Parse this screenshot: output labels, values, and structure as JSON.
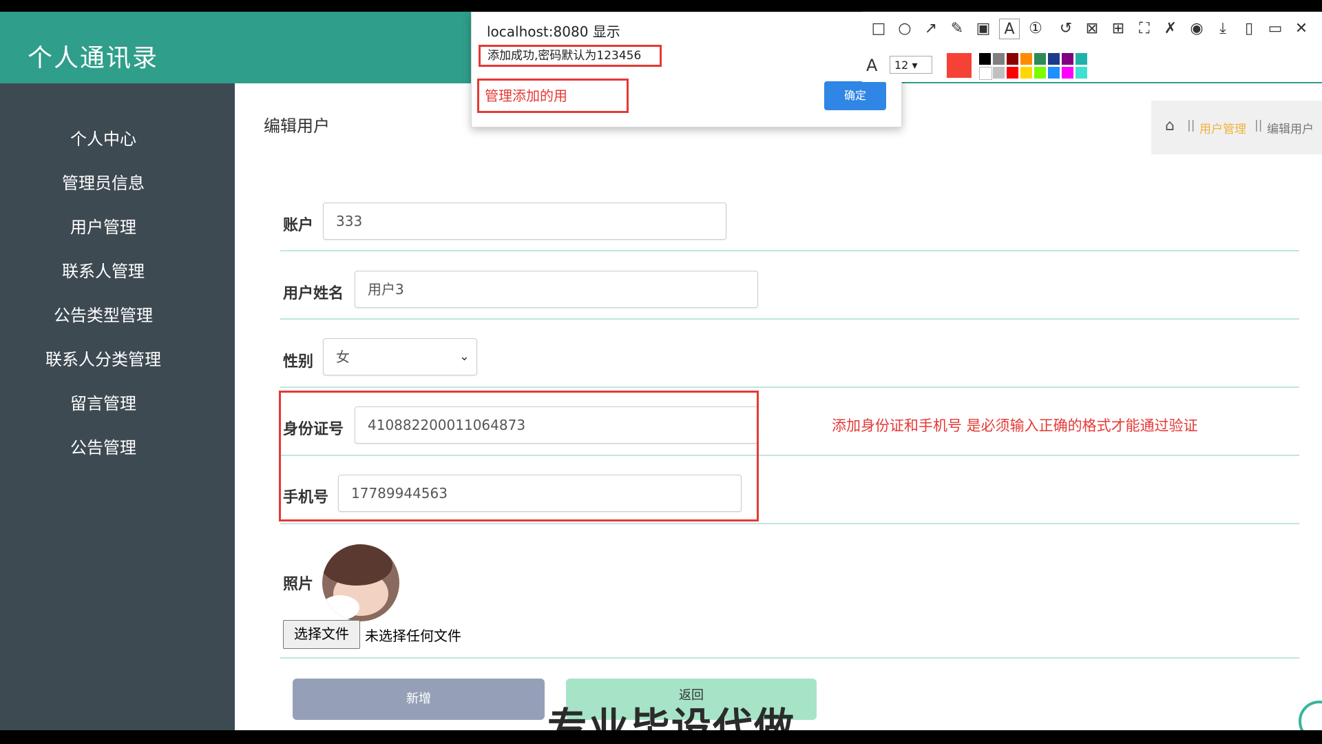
{
  "header": {
    "title": "个人通讯录"
  },
  "sidebar": {
    "items": [
      "个人中心",
      "管理员信息",
      "用户管理",
      "联系人管理",
      "公告类型管理",
      "联系人分类管理",
      "留言管理",
      "公告管理"
    ]
  },
  "page": {
    "title": "编辑用户"
  },
  "breadcrumb": {
    "sep": "||",
    "section": "用户管理",
    "current": "编辑用户"
  },
  "form": {
    "account": {
      "label": "账户",
      "value": "333"
    },
    "name": {
      "label": "用户姓名",
      "value": "用户3"
    },
    "gender": {
      "label": "性别",
      "value": "女"
    },
    "id_card": {
      "label": "身份证号",
      "value": "410882200011064873"
    },
    "phone": {
      "label": "手机号",
      "value": "17789944563"
    },
    "photo": {
      "label": "照片",
      "file_button": "选择文件",
      "file_status": "未选择任何文件"
    },
    "annotation_note": "添加身份证和手机号 是必须输入正确的格式才能通过验证",
    "submit_label": "新增",
    "back_label": "返回"
  },
  "watermark": "专业毕设代做",
  "dialog": {
    "title": "localhost:8080 显示",
    "message": "添加成功,密码默认为123456",
    "annotation": "管理添加的用",
    "ok_label": "确定"
  },
  "toolbar": {
    "font_size": "12",
    "current_color": "#f44336",
    "colors": [
      "#000000",
      "#808080",
      "#8b0000",
      "#ff8c00",
      "#2e8b57",
      "#1e3a8a",
      "#800080",
      "#20b2aa",
      "#ffffff",
      "#c0c0c0",
      "#ff0000",
      "#ffd700",
      "#7cfc00",
      "#1e90ff",
      "#ff00ff",
      "#40e0d0"
    ],
    "icons": [
      "rect-icon",
      "circle-icon",
      "arrow-icon",
      "pencil-icon",
      "mosaic-icon",
      "text-icon",
      "number-icon",
      "undo-icon",
      "crop-icon",
      "translate-icon",
      "fullscreen-icon",
      "pin-icon",
      "record-icon",
      "download-icon",
      "copy-icon",
      "bookmark-icon",
      "close-icon"
    ]
  },
  "colors": {
    "header": "#2f9e8a",
    "sidebar": "#3e4a52",
    "accent_red": "#e53935",
    "ok_blue": "#2f86e4"
  }
}
